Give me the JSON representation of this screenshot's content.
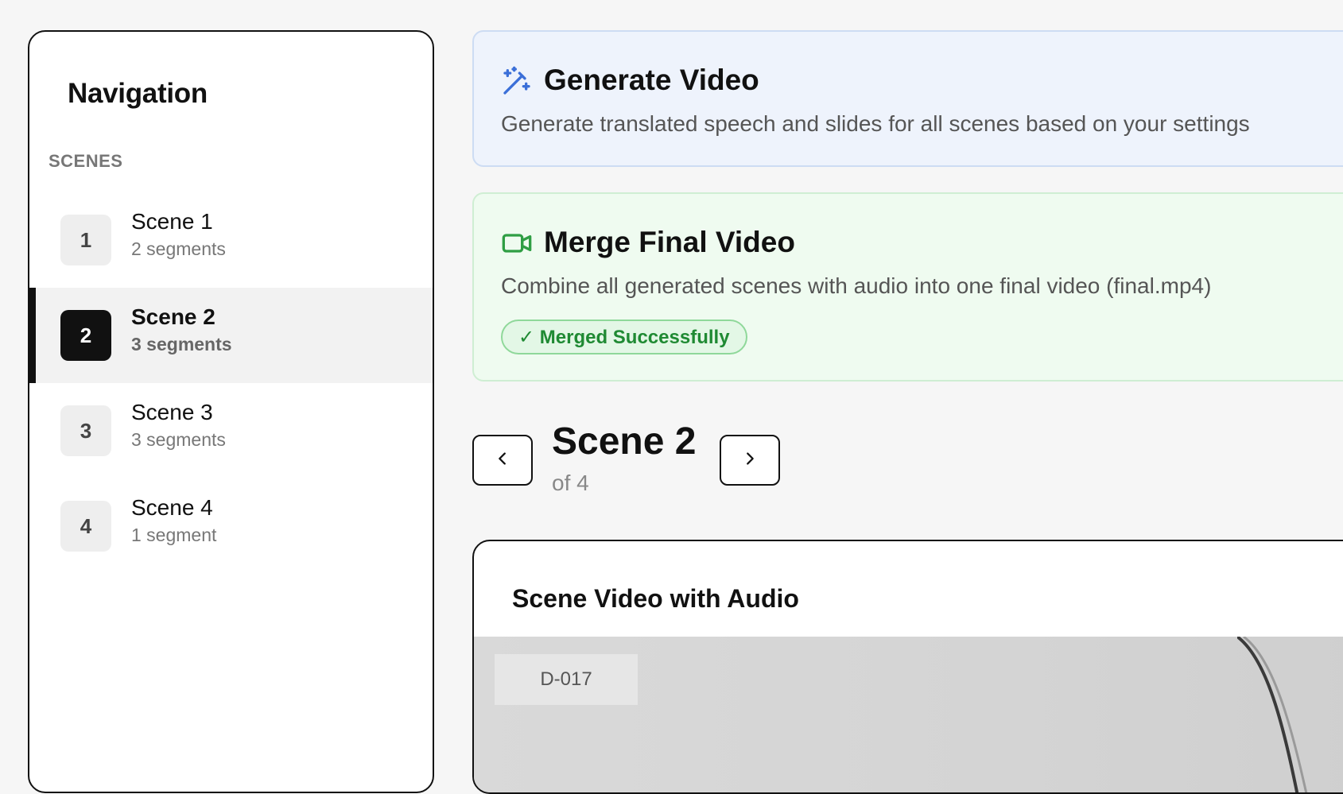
{
  "sidebar": {
    "title": "Navigation",
    "section_label": "SCENES",
    "items": [
      {
        "num": "1",
        "name": "Scene 1",
        "sub": "2 segments"
      },
      {
        "num": "2",
        "name": "Scene 2",
        "sub": "3 segments"
      },
      {
        "num": "3",
        "name": "Scene 3",
        "sub": "3 segments"
      },
      {
        "num": "4",
        "name": "Scene 4",
        "sub": "1 segment"
      }
    ],
    "active_index": 1
  },
  "generate": {
    "title": "Generate Video",
    "description": "Generate translated speech and slides for all scenes based on your settings",
    "icon": "magic-wand-icon"
  },
  "merge": {
    "title": "Merge Final Video",
    "description": "Combine all generated scenes with audio into one final video (final.mp4)",
    "icon": "video-camera-icon",
    "status": "✓ Merged Successfully"
  },
  "scene_nav": {
    "title": "Scene 2",
    "subtitle": "of 4"
  },
  "video_card": {
    "title": "Scene Video with Audio",
    "frame_label": "D-017"
  },
  "colors": {
    "accent_blue": "#3b6fd8",
    "accent_green": "#2f9e44",
    "active": "#111111"
  }
}
